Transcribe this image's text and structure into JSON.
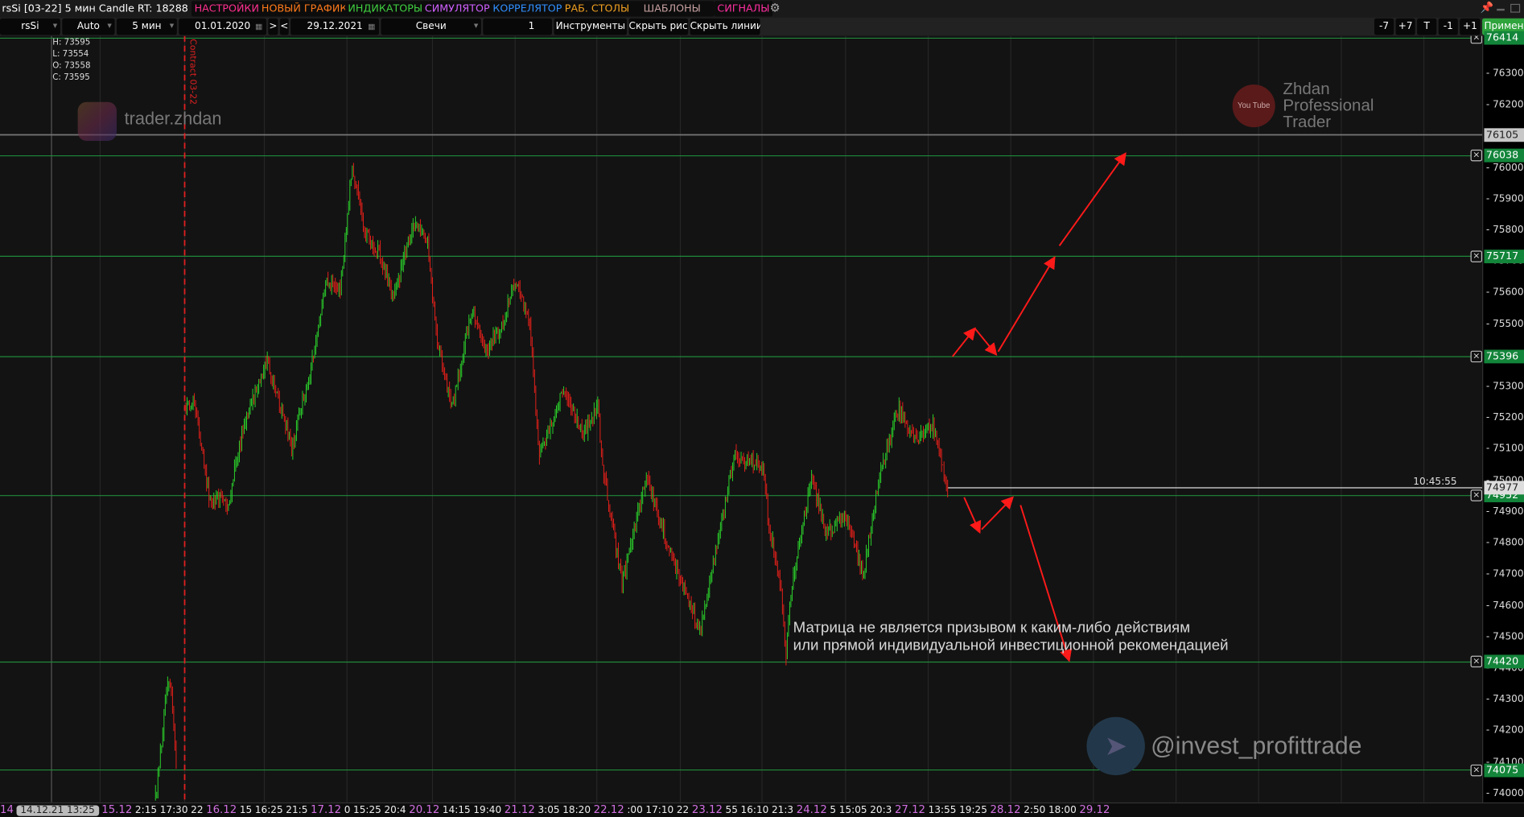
{
  "menubar": {
    "title": "rsSi [03-22] 5 мин Candle RT: 18288",
    "items": [
      {
        "label": "НАСТРОЙКИ",
        "color": "#ff2f8f"
      },
      {
        "label": "НОВЫЙ ГРАФИК",
        "color": "#ff7a1a"
      },
      {
        "label": "ИНДИКАТОРЫ",
        "color": "#3fcf3f"
      },
      {
        "label": "СИМУЛЯТОР",
        "color": "#d060ff"
      },
      {
        "label": "КОРРЕЛЯТОР",
        "color": "#2f8fff"
      },
      {
        "label": "РАБ. СТОЛЫ",
        "color": "#f0a020"
      },
      {
        "label": "ШАБЛОНЫ",
        "color": "#c8a0a0"
      },
      {
        "label": "СИГНАЛЫ",
        "color": "#ff2fa0"
      }
    ]
  },
  "toolbar": {
    "symbol": "rsSi",
    "scale": "Auto",
    "timeframe": "5 мин",
    "date_from": "01.01.2020",
    "next": ">",
    "prev": "<",
    "date_to": "29.12.2021",
    "chart_type": "Свечи",
    "count": "1",
    "instruments": "Инструменты",
    "hide_drawings": "Скрыть рис.",
    "hide_lines": "Скрыть линии",
    "shift_buttons": [
      "-7",
      "+7",
      "T",
      "-1",
      "+1"
    ],
    "apply": "Применить"
  },
  "ohlc": {
    "h": "H: 73595",
    "l": "L: 73554",
    "o": "O: 73558",
    "c": "C: 73595"
  },
  "contract_label": "Contract 03-22",
  "watermarks": {
    "instagram": "trader.zhdan",
    "youtube_badge": "You Tube",
    "youtube": [
      "Zhdan",
      "Professional",
      "Trader"
    ],
    "telegram": "@invest_profittrade"
  },
  "disclaimer": [
    "Матрица не является призывом к каким-либо действиям",
    "или прямой индивидуальной инвестиционной рекомендацией"
  ],
  "current_price": {
    "value": "74977",
    "time": "10:45:55"
  },
  "chart_data": {
    "type": "candlestick",
    "price_ticks": [
      76300,
      76200,
      76100,
      76000,
      75900,
      75800,
      75700,
      75600,
      75500,
      75400,
      75300,
      75200,
      75100,
      75000,
      74900,
      74800,
      74700,
      74600,
      74500,
      74400,
      74300,
      74200,
      74100,
      74000
    ],
    "ylim": [
      73990,
      76420
    ],
    "levels": [
      {
        "price": 76414,
        "label": "76414",
        "style": "green"
      },
      {
        "price": 76105,
        "label": "76105",
        "style": "gray"
      },
      {
        "price": 76038,
        "label": "76038",
        "style": "green"
      },
      {
        "price": 75717,
        "label": "75717",
        "style": "green"
      },
      {
        "price": 75396,
        "label": "75396",
        "style": "green"
      },
      {
        "price": 74952,
        "label": "74952",
        "style": "green"
      },
      {
        "price": 74420,
        "label": "74420",
        "style": "green"
      },
      {
        "price": 74075,
        "label": "74075",
        "style": "green"
      }
    ],
    "price_path_approx": [
      [
        160,
        73990
      ],
      [
        166,
        74150
      ],
      [
        172,
        74362
      ],
      [
        177,
        74300
      ],
      [
        182,
        74052
      ],
      [
        190,
        75232
      ],
      [
        200,
        75250
      ],
      [
        215,
        74952
      ],
      [
        235,
        74921
      ],
      [
        250,
        75170
      ],
      [
        275,
        75387
      ],
      [
        300,
        75108
      ],
      [
        320,
        75356
      ],
      [
        335,
        75636
      ],
      [
        350,
        75605
      ],
      [
        362,
        76008
      ],
      [
        375,
        75791
      ],
      [
        390,
        75729
      ],
      [
        405,
        75574
      ],
      [
        425,
        75822
      ],
      [
        440,
        75760
      ],
      [
        450,
        75449
      ],
      [
        465,
        75232
      ],
      [
        485,
        75542
      ],
      [
        500,
        75418
      ],
      [
        515,
        75480
      ],
      [
        530,
        75636
      ],
      [
        545,
        75511
      ],
      [
        550,
        75294
      ],
      [
        555,
        75077
      ],
      [
        580,
        75294
      ],
      [
        600,
        75139
      ],
      [
        615,
        75232
      ],
      [
        620,
        75046
      ],
      [
        640,
        74673
      ],
      [
        665,
        75015
      ],
      [
        690,
        74766
      ],
      [
        720,
        74518
      ],
      [
        740,
        74828
      ],
      [
        755,
        75077
      ],
      [
        785,
        75046
      ],
      [
        790,
        74890
      ],
      [
        805,
        74610
      ],
      [
        808,
        74425
      ],
      [
        815,
        74673
      ],
      [
        835,
        75015
      ],
      [
        850,
        74828
      ],
      [
        870,
        74890
      ],
      [
        888,
        74700
      ],
      [
        905,
        75015
      ],
      [
        925,
        75232
      ],
      [
        940,
        75139
      ],
      [
        960,
        75170
      ],
      [
        975,
        74977
      ]
    ],
    "time_labels": [
      {
        "t": "14",
        "day": true
      },
      {
        "t": "14.12.21 13:25",
        "cursor": true
      },
      {
        "t": "15.12",
        "day": true
      },
      {
        "t": "2:15"
      },
      {
        "t": "17:30"
      },
      {
        "t": "22"
      },
      {
        "t": "16.12",
        "day": true
      },
      {
        "t": "15"
      },
      {
        "t": "16:25"
      },
      {
        "t": "21:5"
      },
      {
        "t": "17.12",
        "day": true
      },
      {
        "t": "0"
      },
      {
        "t": "15:25"
      },
      {
        "t": "20:4"
      },
      {
        "t": "20.12",
        "day": true
      },
      {
        "t": "14:15"
      },
      {
        "t": "19:40"
      },
      {
        "t": "21.12",
        "day": true
      },
      {
        "t": "3:05"
      },
      {
        "t": "18:20"
      },
      {
        "t": "22.12",
        "day": true
      },
      {
        "t": ":00"
      },
      {
        "t": "17:10"
      },
      {
        "t": "22"
      },
      {
        "t": "23.12",
        "day": true
      },
      {
        "t": "55"
      },
      {
        "t": "16:10"
      },
      {
        "t": "21:3"
      },
      {
        "t": "24.12",
        "day": true
      },
      {
        "t": "5"
      },
      {
        "t": "15:05"
      },
      {
        "t": "20:3"
      },
      {
        "t": "27.12",
        "day": true
      },
      {
        "t": "13:55"
      },
      {
        "t": "19:25"
      },
      {
        "t": "28.12",
        "day": true
      },
      {
        "t": "2:50"
      },
      {
        "t": "18:00"
      },
      {
        "t": "29.12",
        "day": true
      }
    ],
    "up_color": "#2bd42b",
    "down_color": "#e8201a"
  }
}
